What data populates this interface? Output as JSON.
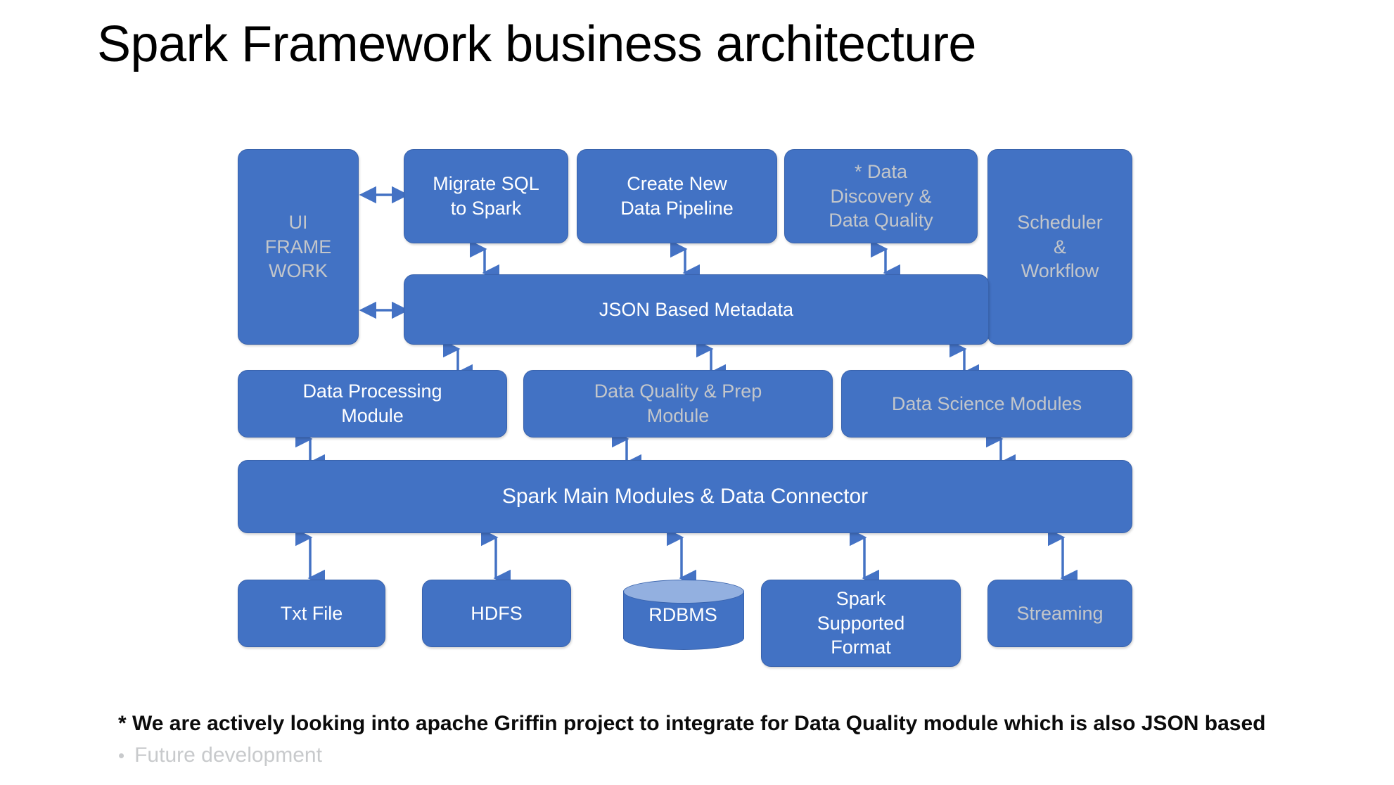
{
  "slide": {
    "title": "Spark Framework business architecture",
    "background_color": "#FFFFFF",
    "accent_color": "#4472C4",
    "dim_text_color": "#C3C6CA",
    "active_text_color": "#FFFFFF"
  },
  "layers": {
    "ui_framework": {
      "label": "UI\nFRAME\nWORK",
      "state": "future"
    },
    "top_row": [
      {
        "label": "Migrate SQL\nto Spark",
        "state": "active"
      },
      {
        "label": "Create New\nData Pipeline",
        "state": "active"
      },
      {
        "label": "* Data\nDiscovery &\nData Quality",
        "state": "future"
      }
    ],
    "scheduler": {
      "label": "Scheduler\n&\nWorkflow",
      "state": "future"
    },
    "metadata": {
      "label": "JSON Based Metadata",
      "state": "active"
    },
    "modules": [
      {
        "label": "Data Processing\nModule",
        "state": "active"
      },
      {
        "label": "Data Quality & Prep\nModule",
        "state": "future"
      },
      {
        "label": "Data Science Modules",
        "state": "future"
      }
    ],
    "spark_core": {
      "label": "Spark Main Modules & Data Connector",
      "state": "active"
    },
    "sources": [
      {
        "label": "Txt File",
        "state": "active",
        "shape": "rounded-rect"
      },
      {
        "label": "HDFS",
        "state": "active",
        "shape": "rounded-rect"
      },
      {
        "label": "RDBMS",
        "state": "active",
        "shape": "cylinder"
      },
      {
        "label": "Spark\nSupported\nFormat",
        "state": "active",
        "shape": "rounded-rect"
      },
      {
        "label": "Streaming",
        "state": "future",
        "shape": "rounded-rect"
      }
    ]
  },
  "footnotes": {
    "asterisk_note": "* We are actively looking into apache Griffin project to integrate for Data Quality module which is also JSON based",
    "legend_bullet": "•",
    "legend_label": "Future development"
  }
}
